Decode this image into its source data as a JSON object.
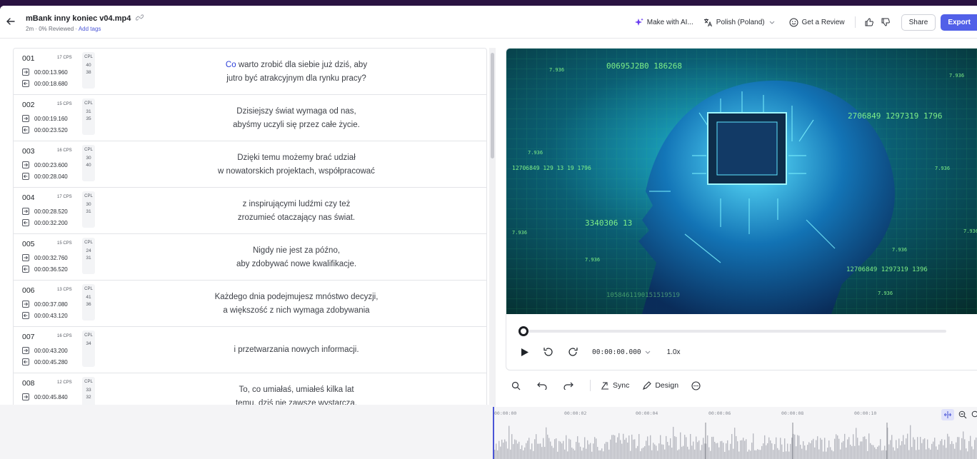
{
  "header": {
    "title": "mBank inny koniec v04.mp4",
    "subtitle": "2m · 0% Reviewed · ",
    "add_tags": "Add tags",
    "make_ai": "Make with AI...",
    "language": "Polish (Poland)",
    "review": "Get a Review",
    "share": "Share",
    "export": "Export"
  },
  "rows": [
    {
      "num": "001",
      "cps": "17 CPS",
      "cpl": "CPL",
      "cpl1": "40",
      "cpl2": "38",
      "tin": "00:00:13.960",
      "tout": "00:00:18.680",
      "hl": "Co",
      "line1": " warto zrobić dla siebie już dziś, aby",
      "line2": "jutro być atrakcyjnym dla rynku pracy?"
    },
    {
      "num": "002",
      "cps": "15 CPS",
      "cpl": "CPL",
      "cpl1": "31",
      "cpl2": "35",
      "tin": "00:00:19.160",
      "tout": "00:00:23.520",
      "hl": "",
      "line1": "Dzisiejszy świat wymaga od nas,",
      "line2": "abyśmy uczyli się przez całe życie."
    },
    {
      "num": "003",
      "cps": "16 CPS",
      "cpl": "CPL",
      "cpl1": "30",
      "cpl2": "40",
      "tin": "00:00:23.600",
      "tout": "00:00:28.040",
      "hl": "",
      "line1": "Dzięki temu możemy brać udział",
      "line2": "w nowatorskich projektach, współpracować"
    },
    {
      "num": "004",
      "cps": "17 CPS",
      "cpl": "CPL",
      "cpl1": "30",
      "cpl2": "31",
      "tin": "00:00:28.520",
      "tout": "00:00:32.200",
      "hl": "",
      "line1": "z inspirującymi ludźmi czy też",
      "line2": "zrozumieć otaczający nas świat."
    },
    {
      "num": "005",
      "cps": "15 CPS",
      "cpl": "CPL",
      "cpl1": "24",
      "cpl2": "31",
      "tin": "00:00:32.760",
      "tout": "00:00:36.520",
      "hl": "",
      "line1": "Nigdy nie jest za późno,",
      "line2": "aby zdobywać nowe kwalifikacje."
    },
    {
      "num": "006",
      "cps": "13 CPS",
      "cpl": "CPL",
      "cpl1": "41",
      "cpl2": "36",
      "tin": "00:00:37.080",
      "tout": "00:00:43.120",
      "hl": "",
      "line1": "Każdego dnia podejmujesz mnóstwo decyzji,",
      "line2": "a większość z nich wymaga zdobywania"
    },
    {
      "num": "007",
      "cps": "16 CPS",
      "cpl": "CPL",
      "cpl1": "34",
      "cpl2": "",
      "tin": "00:00:43.200",
      "tout": "00:00:45.280",
      "hl": "",
      "line1": "i przetwarzania nowych informacji.",
      "line2": ""
    },
    {
      "num": "008",
      "cps": "12 CPS",
      "cpl": "CPL",
      "cpl1": "33",
      "cpl2": "32",
      "tin": "00:00:45.840",
      "tout": "",
      "hl": "",
      "line1": "To, co umiałaś, umiałeś kilka lat",
      "line2": "temu, dziś nie zawsze wystarcza."
    }
  ],
  "player": {
    "timecode": "00:00:00.000",
    "speed": "1.0x",
    "progress": 0
  },
  "tools": {
    "sync": "Sync",
    "design": "Design"
  },
  "timeline": {
    "ticks": [
      "00:00:00",
      "00:00:02",
      "00:00:04",
      "00:00:06",
      "00:00:08",
      "00:00:10"
    ]
  },
  "colors": {
    "accent": "#5160e8",
    "frame": "#2a1241"
  }
}
